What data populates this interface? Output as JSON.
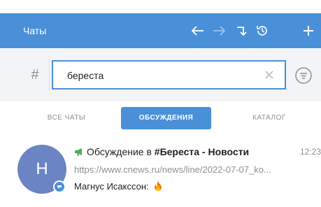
{
  "header": {
    "title": "Чаты",
    "icons": [
      "back-arrow-icon",
      "forward-arrow-icon",
      "jump-arrow-icon",
      "history-clock-icon",
      "plus-icon"
    ],
    "accent_color": "#4a90d9"
  },
  "search": {
    "prefix_symbol": "#",
    "value": "береста",
    "clear_icon": "close-icon",
    "filter_icon": "filter-list-icon"
  },
  "tabs": [
    {
      "label": "ВСЕ ЧАТЫ",
      "active": false
    },
    {
      "label": "ОБСУЖДЕНИЯ",
      "active": true
    },
    {
      "label": "КАТАЛОГ",
      "active": false
    }
  ],
  "chats": [
    {
      "avatar_letter": "Н",
      "avatar_color": "#6a84c4",
      "title_prefix": "Обсуждение в ",
      "title_bold": "#Береста - Новости",
      "time": "12:23",
      "preview": "https://www.cnews.ru/news/line/2022-07-07_ko...",
      "sender": "Магнус Исакссон:",
      "sender_emoji_icon": "fire-icon"
    }
  ]
}
